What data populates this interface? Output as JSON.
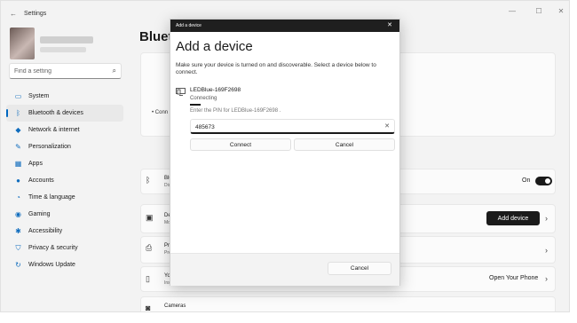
{
  "window": {
    "title": "Settings",
    "page_title": "Blueto",
    "controls": {
      "minimize": "—",
      "maximize": "☐",
      "close": "✕"
    }
  },
  "search": {
    "placeholder": "Find a setting",
    "value": ""
  },
  "sidebar": {
    "items": [
      {
        "label": "System",
        "icon": "monitor-icon",
        "glyph": "▭",
        "active": false
      },
      {
        "label": "Bluetooth & devices",
        "icon": "bluetooth-icon",
        "glyph": "ᛒ",
        "active": true
      },
      {
        "label": "Network & internet",
        "icon": "wifi-icon",
        "glyph": "◆",
        "active": false
      },
      {
        "label": "Personalization",
        "icon": "brush-icon",
        "glyph": "✎",
        "active": false
      },
      {
        "label": "Apps",
        "icon": "apps-icon",
        "glyph": "▦",
        "active": false
      },
      {
        "label": "Accounts",
        "icon": "person-icon",
        "glyph": "●",
        "active": false
      },
      {
        "label": "Time & language",
        "icon": "globe-clock-icon",
        "glyph": "◔",
        "active": false
      },
      {
        "label": "Gaming",
        "icon": "gamepad-icon",
        "glyph": "◉",
        "active": false
      },
      {
        "label": "Accessibility",
        "icon": "accessibility-icon",
        "glyph": "✱",
        "active": false
      },
      {
        "label": "Privacy & security",
        "icon": "shield-icon",
        "glyph": "⛉",
        "active": false
      },
      {
        "label": "Windows Update",
        "icon": "refresh-icon",
        "glyph": "↻",
        "active": false
      }
    ]
  },
  "main": {
    "connect_fragment": "• Conn",
    "bluetooth_row": {
      "title": "Blu",
      "subtitle": "Dis",
      "toggle_label": "On",
      "toggle_on": true
    },
    "devices_row": {
      "title": "De",
      "subtitle": "Mo",
      "button": "Add device"
    },
    "printers_row": {
      "title": "Pri",
      "subtitle": "Pre"
    },
    "phone_row": {
      "title": "Yo",
      "subtitle": "Ins",
      "link": "Open Your Phone"
    },
    "cameras_row": {
      "title": "Cameras"
    },
    "chevron": "›"
  },
  "dialog": {
    "titlebar": "Add a device",
    "close_glyph": "✕",
    "heading": "Add a device",
    "description": "Make sure your device is turned on and discoverable. Select a device below to connect.",
    "device": {
      "name": "LEDBlue-169F2698",
      "status": "Connecting",
      "pin_prompt": "Enter the PIN for LEDBlue-169F2698 .",
      "pin_value": "485673",
      "clear_glyph": "✕"
    },
    "buttons": {
      "connect": "Connect",
      "cancel": "Cancel",
      "footer_cancel": "Cancel"
    }
  }
}
